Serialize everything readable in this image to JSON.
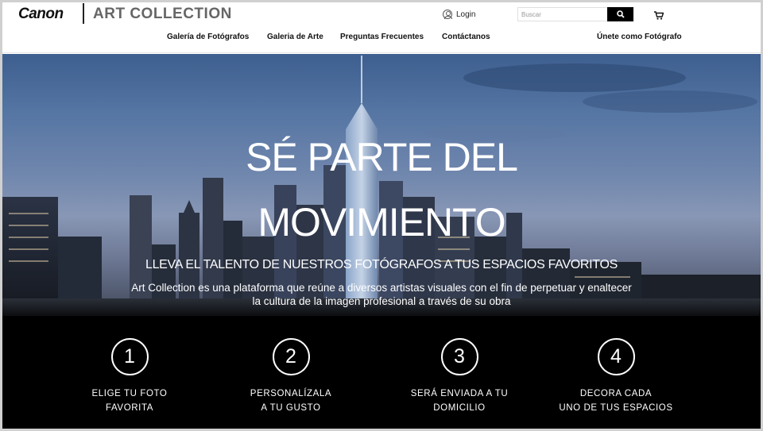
{
  "brand": {
    "canon": "Canon",
    "collection": "ART COLLECTION"
  },
  "header": {
    "login_label": "Login",
    "search_placeholder": "Buscar",
    "nav": [
      "Galería de Fotógrafos",
      "Galeria de Arte",
      "Preguntas Frecuentes",
      "Contáctanos"
    ],
    "join_label": "Únete como Fotógrafo"
  },
  "hero": {
    "title_line1": "SÉ PARTE DEL",
    "title_line2": "MOVIMIENTO",
    "subtitle": "LLEVA EL TALENTO DE NUESTROS FOTÓGRAFOS A TUS ESPACIOS FAVORITOS",
    "description": "Art Collection es una plataforma que reúne a diversos artistas visuales con el fin de perpetuar y enaltecer la cultura de la imagen profesional a través de su obra"
  },
  "steps": [
    {
      "number": "1",
      "line1": "ELIGE TU FOTO",
      "line2": "FAVORITA"
    },
    {
      "number": "2",
      "line1": "PERSONALÍZALA",
      "line2": "A TU GUSTO"
    },
    {
      "number": "3",
      "line1": "SERÁ ENVIADA A TU",
      "line2": "DOMICILIO"
    },
    {
      "number": "4",
      "line1": "DECORA CADA",
      "line2": "UNO DE TUS ESPACIOS"
    }
  ],
  "icons": {
    "login": "user-icon",
    "search": "search-icon",
    "cart": "cart-icon"
  },
  "colors": {
    "hero_sky": "#4d6a99",
    "steps_bg": "#000000",
    "search_button": "#000000"
  }
}
